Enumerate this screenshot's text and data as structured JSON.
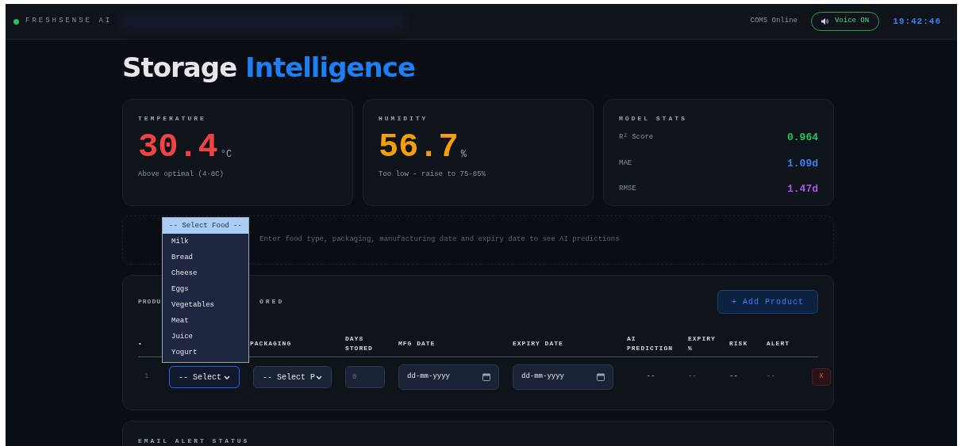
{
  "header": {
    "brand": "FRESHSENSE AI",
    "port_status": "COM5 Online",
    "voice_button": {
      "label": "Voice ON",
      "on": true
    },
    "clock": "19:42:46"
  },
  "title": {
    "plain": "Storage",
    "accent": "Intelligence"
  },
  "cards": [
    {
      "kind": "reading",
      "label": "TEMPERATURE",
      "value": "30.4",
      "unit": "°C",
      "note": "Above optimal (4-8C)",
      "color": "#ef4444"
    },
    {
      "kind": "reading",
      "label": "HUMIDITY",
      "value": "56.7",
      "unit": "%",
      "note": "Too low - raise to 75-85%",
      "color": "#f59e0b"
    },
    {
      "kind": "stats",
      "label": "MODEL STATS",
      "rows": [
        {
          "label": "R² Score",
          "value": "0.964",
          "color": "#22c55e"
        },
        {
          "label": "MAE",
          "value": "1.09d",
          "color": "#3b82f6"
        },
        {
          "label": "RMSE",
          "value": "1.47d",
          "color": "#a855f7"
        }
      ]
    }
  ],
  "info_text": "Enter food type, packaging, manufacturing date and expiry date to see AI predictions",
  "products": {
    "title_parts": [
      "PRODU",
      "ORED"
    ],
    "add_button": "+ Add Product",
    "columns": [
      "•",
      "PACKAGING",
      "DAYS STORED",
      "MFG DATE",
      "EXPIRY DATE",
      "AI PREDICTION",
      "EXPIRY %",
      "RISK",
      "ALERT"
    ],
    "rows": [
      {
        "index": "1",
        "food": "-- Select",
        "packaging": "-- Select P",
        "days_placeholder": "0",
        "mfg_placeholder": "dd-mm-yyyy",
        "expiry_placeholder": "dd-mm-yyyy",
        "prediction": "--",
        "expiry_pct": "--",
        "risk": "--",
        "alert": "--",
        "delete": "X"
      }
    ]
  },
  "food_dropdown": {
    "options": [
      {
        "label": "-- Select Food --",
        "selected": true
      },
      {
        "label": "Milk",
        "selected": false
      },
      {
        "label": "Bread",
        "selected": false
      },
      {
        "label": "Cheese",
        "selected": false
      },
      {
        "label": "Eggs",
        "selected": false
      },
      {
        "label": "Vegetables",
        "selected": false
      },
      {
        "label": "Meat",
        "selected": false
      },
      {
        "label": "Juice",
        "selected": false
      },
      {
        "label": "Yogurt",
        "selected": false
      }
    ]
  },
  "email_panel": {
    "title": "EMAIL ALERT STATUS"
  }
}
